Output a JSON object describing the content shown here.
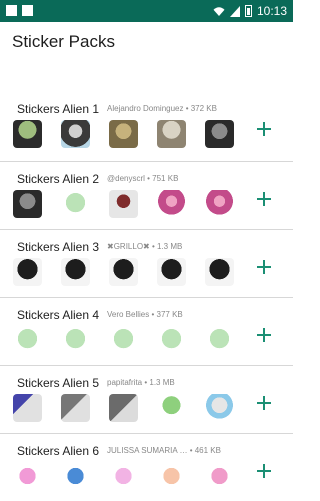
{
  "status_bar": {
    "time": "10:13",
    "bg_color": "#0a6a58"
  },
  "app_bar": {
    "title": "Sticker Packs"
  },
  "accent_color": "#1b8f74",
  "packs": [
    {
      "name": "Stickers Alien 1",
      "meta": "Alejandro Dominguez • 372 KB",
      "add_icon": "plus-icon"
    },
    {
      "name": "Stickers Alien 2",
      "meta": "@denyscrl • 751 KB",
      "add_icon": "plus-icon"
    },
    {
      "name": "Stickers Alien 3",
      "meta": "✖GRILLO✖ • 1.3 MB",
      "add_icon": "plus-icon"
    },
    {
      "name": "Stickers Alien 4",
      "meta": "Vero Bellies • 377 KB",
      "add_icon": "plus-icon"
    },
    {
      "name": "Stickers Alien 5",
      "meta": "papitafrita • 1.3 MB",
      "add_icon": "plus-icon"
    },
    {
      "name": "Stickers Alien 6",
      "meta": "JULISSA SUMARIA … • 461 KB",
      "add_icon": "plus-icon"
    }
  ]
}
